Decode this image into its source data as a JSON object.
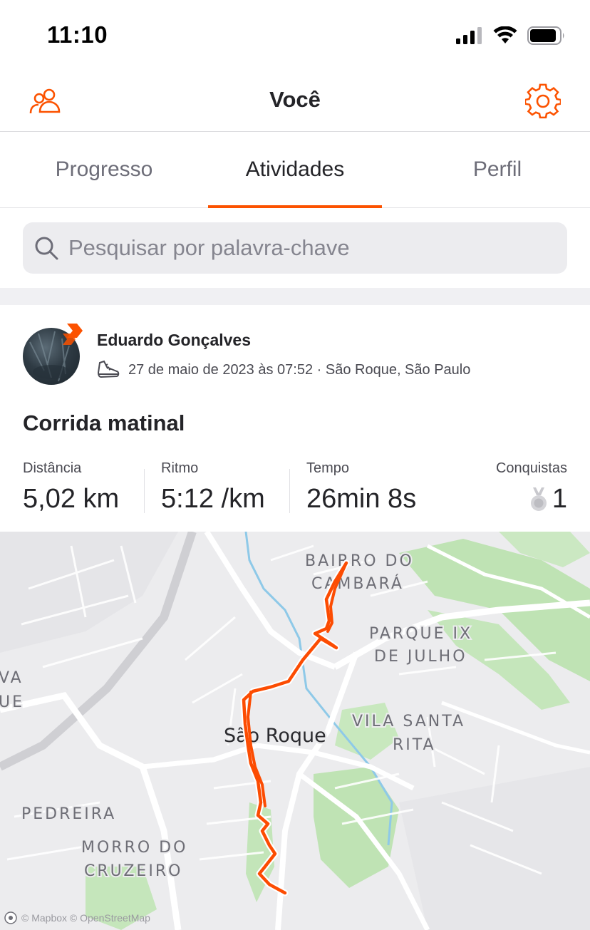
{
  "status_bar": {
    "time": "11:10"
  },
  "header": {
    "title": "Você",
    "left_icon": "friends-icon",
    "right_icon": "gear-icon"
  },
  "tabs": [
    {
      "label": "Progresso",
      "active": false
    },
    {
      "label": "Atividades",
      "active": true
    },
    {
      "label": "Perfil",
      "active": false
    }
  ],
  "search": {
    "placeholder": "Pesquisar por palavra-chave",
    "value": ""
  },
  "activity": {
    "athlete_name": "Eduardo Gonçalves",
    "meta": "27 de maio de 2023 às 07:52 · São Roque, São Paulo",
    "activity_icon": "running-shoe-icon",
    "title": "Corrida matinal",
    "stats": {
      "distance": {
        "label": "Distância",
        "value": "5,02 km"
      },
      "pace": {
        "label": "Ritmo",
        "value": "5:12 /km"
      },
      "time": {
        "label": "Tempo",
        "value": "26min 8s"
      },
      "achievements": {
        "label": "Conquistas",
        "value": "1"
      }
    }
  },
  "map": {
    "labels": {
      "bairro1": "BAIRRO DO",
      "bairro2": "CAMBARÁ",
      "parque1": "PARQUE IX",
      "parque2": "DE JULHO",
      "vila1": "VILA SANTA",
      "vila2": "RITA",
      "city": "São Roque",
      "pedreira": "PEDREIRA",
      "morro1": "MORRO DO",
      "morro2": "CRUZEIRO",
      "edge1": "VA",
      "edge2": "UE"
    },
    "attribution": "© Mapbox © OpenStreetMap"
  },
  "colors": {
    "accent": "#fc5200",
    "route": "#fc4c02",
    "park": "#bfe3b4",
    "water": "#8ec9e8"
  }
}
